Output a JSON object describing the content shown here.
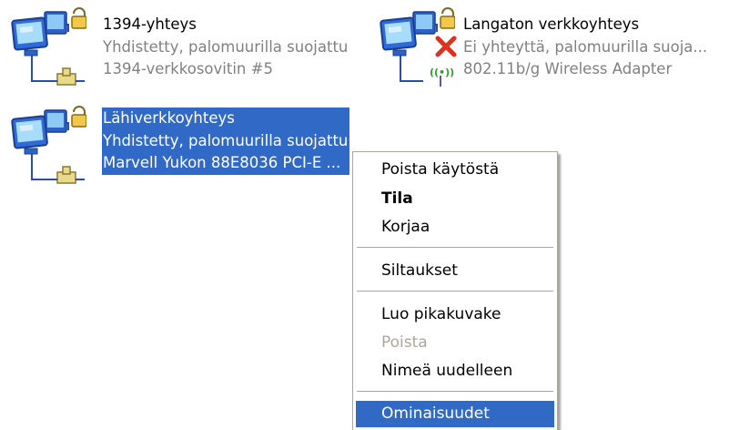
{
  "connections": [
    {
      "name": "1394-yhteys",
      "status": "Yhdistetty, palomuurilla suojattu",
      "device": "1394-verkkosovitin #5",
      "icon": "network-connection-icon",
      "state": "firewalled"
    },
    {
      "name": "Langaton verkkoyhteys",
      "status": "Ei yhteyttä, palomuurilla suoja...",
      "device": "802.11b/g Wireless Adapter",
      "icon": "wireless-connection-icon",
      "state": "disconnected"
    },
    {
      "name": "Lähiverkkoyhteys",
      "status": "Yhdistetty, palomuurilla suojattu",
      "device": "Marvell Yukon 88E8036 PCI-E ...",
      "icon": "network-connection-icon",
      "state": "firewalled",
      "selected": true
    }
  ],
  "context_menu": {
    "items": [
      {
        "label": "Poista käytöstä"
      },
      {
        "label": "Tila",
        "bold": true
      },
      {
        "label": "Korjaa"
      },
      {
        "label": "Siltaukset"
      },
      {
        "label": "Luo pikakuvake"
      },
      {
        "label": "Poista",
        "disabled": true
      },
      {
        "label": "Nimeä uudelleen"
      },
      {
        "label": "Ominaisuudet",
        "highlighted": true
      }
    ]
  },
  "colors": {
    "selection": "#3169c6",
    "menu_highlight": "#316ac5",
    "disabled_text": "#aca899",
    "secondary_text": "#808080",
    "error_red": "#e0301e",
    "wireless_green": "#2aa02a"
  }
}
